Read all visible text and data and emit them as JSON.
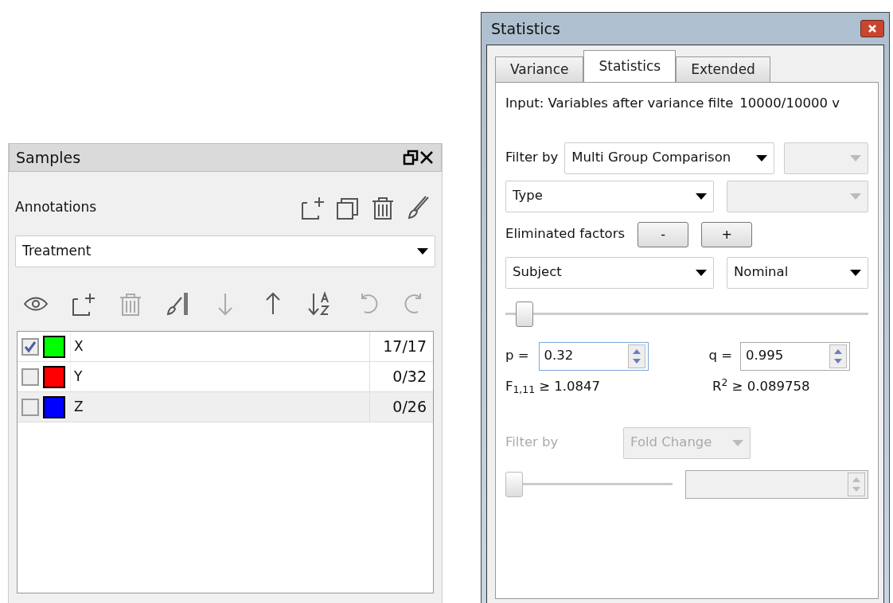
{
  "samples_panel": {
    "title": "Samples",
    "annotations_label": "Annotations",
    "annotation_tools": [
      {
        "kind": "add",
        "disabled": false
      },
      {
        "kind": "copy",
        "disabled": false
      },
      {
        "kind": "delete",
        "disabled": false
      },
      {
        "kind": "brush",
        "disabled": false
      }
    ],
    "annotation_select": {
      "value": "Treatment"
    },
    "group_tools": [
      {
        "kind": "eye",
        "disabled": false
      },
      {
        "kind": "add",
        "disabled": false
      },
      {
        "kind": "delete",
        "disabled": true
      },
      {
        "kind": "gradient",
        "disabled": false
      },
      {
        "kind": "down",
        "disabled": true
      },
      {
        "kind": "up",
        "disabled": false
      },
      {
        "kind": "sort",
        "disabled": false
      },
      {
        "kind": "undo",
        "disabled": true
      },
      {
        "kind": "redo",
        "disabled": true
      }
    ],
    "groups": [
      {
        "checked": true,
        "color": "#00ff00",
        "label": "X",
        "count": "17/17",
        "selected": false
      },
      {
        "checked": false,
        "color": "#ff0000",
        "label": "Y",
        "count": "0/32",
        "selected": false
      },
      {
        "checked": false,
        "color": "#0000ff",
        "label": "Z",
        "count": "0/26",
        "selected": true
      }
    ]
  },
  "statistics_window": {
    "title": "Statistics",
    "tabs": [
      {
        "label": "Variance",
        "selected": false
      },
      {
        "label": "Statistics",
        "selected": true
      },
      {
        "label": "Extended",
        "selected": false
      }
    ],
    "input_text": "Input: Variables after variance filte",
    "input_count": "10000/10000 v",
    "filter_label": "Filter by",
    "filter_select": {
      "value": "Multi Group Comparison",
      "disabled": false
    },
    "filter_option_select": {
      "disabled": true
    },
    "type_select": {
      "value": "Type",
      "disabled": false
    },
    "type_option_select": {
      "disabled": true
    },
    "eliminated_label": "Eliminated factors",
    "eliminated_buttons": [
      "-",
      "+"
    ],
    "factor_select": {
      "value": "Subject",
      "disabled": false
    },
    "scale_select": {
      "value": "Nominal",
      "disabled": false
    },
    "slider": {
      "level": 0.03,
      "disabled": false
    },
    "p_label": "p =",
    "p_value": "0.32",
    "q_label": "q =",
    "q_value": "0.995",
    "f_stat": "F$_{1,11}$ ≥ 1.0847",
    "r_stat": "R$^{2}$ ≥ 0.089758",
    "second_filter_label": "Filter by",
    "second_filter_select": {
      "value": "Fold Change",
      "disabled": true
    },
    "second_slider": {
      "level": 0,
      "disabled": true
    }
  }
}
